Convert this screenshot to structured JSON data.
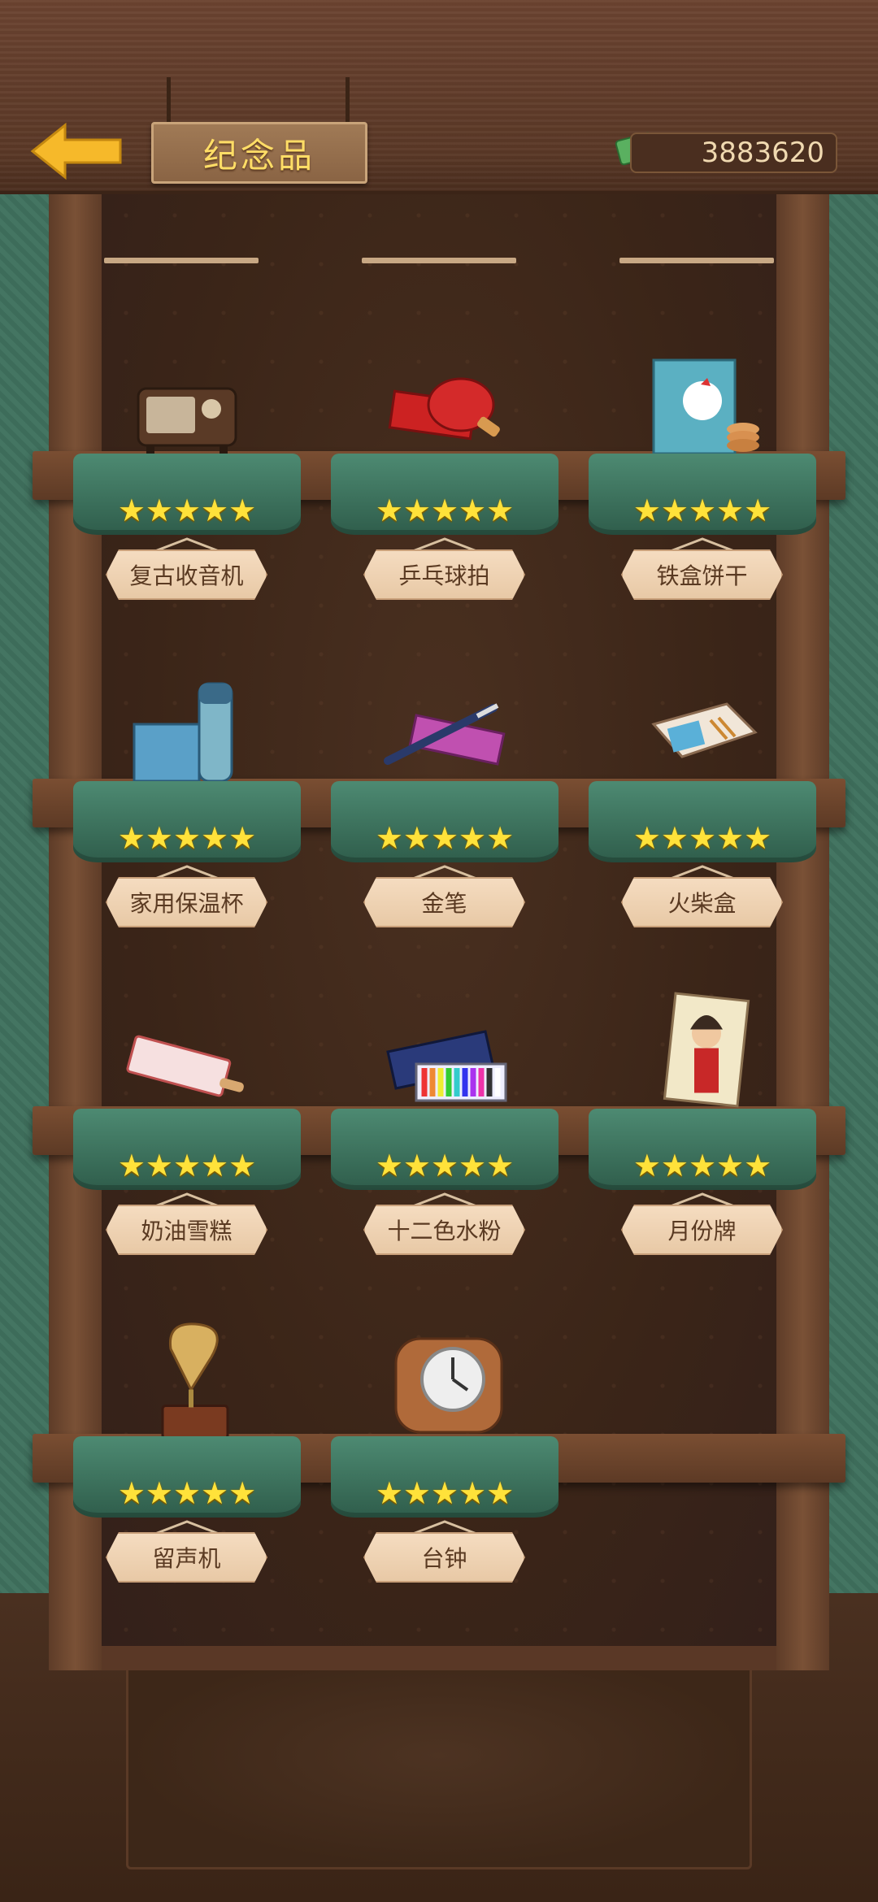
{
  "header": {
    "title": "纪念品",
    "currency": "3883620"
  },
  "colors": {
    "star": "#ffe23a",
    "cloth": "#3f7a63",
    "wood": "#5a3826",
    "tag_text": "#5a3a22"
  },
  "items": [
    {
      "name": "复古收音机",
      "stars": "★★★★★",
      "icon": "radio-icon"
    },
    {
      "name": "乒乓球拍",
      "stars": "★★★★★",
      "icon": "ping-pong-paddle-icon"
    },
    {
      "name": "铁盒饼干",
      "stars": "★★★★★",
      "icon": "biscuit-tin-icon"
    },
    {
      "name": "家用保温杯",
      "stars": "★★★★★",
      "icon": "thermos-icon"
    },
    {
      "name": "金笔",
      "stars": "★★★★★",
      "icon": "fountain-pen-icon"
    },
    {
      "name": "火柴盒",
      "stars": "★★★★★",
      "icon": "matchbox-icon"
    },
    {
      "name": "奶油雪糕",
      "stars": "★★★★★",
      "icon": "ice-cream-icon"
    },
    {
      "name": "十二色水粉",
      "stars": "★★★★★",
      "icon": "paint-set-icon"
    },
    {
      "name": "月份牌",
      "stars": "★★★★★",
      "icon": "calendar-poster-icon"
    },
    {
      "name": "留声机",
      "stars": "★★★★★",
      "icon": "gramophone-icon"
    },
    {
      "name": "台钟",
      "stars": "★★★★★",
      "icon": "desk-clock-icon"
    }
  ]
}
